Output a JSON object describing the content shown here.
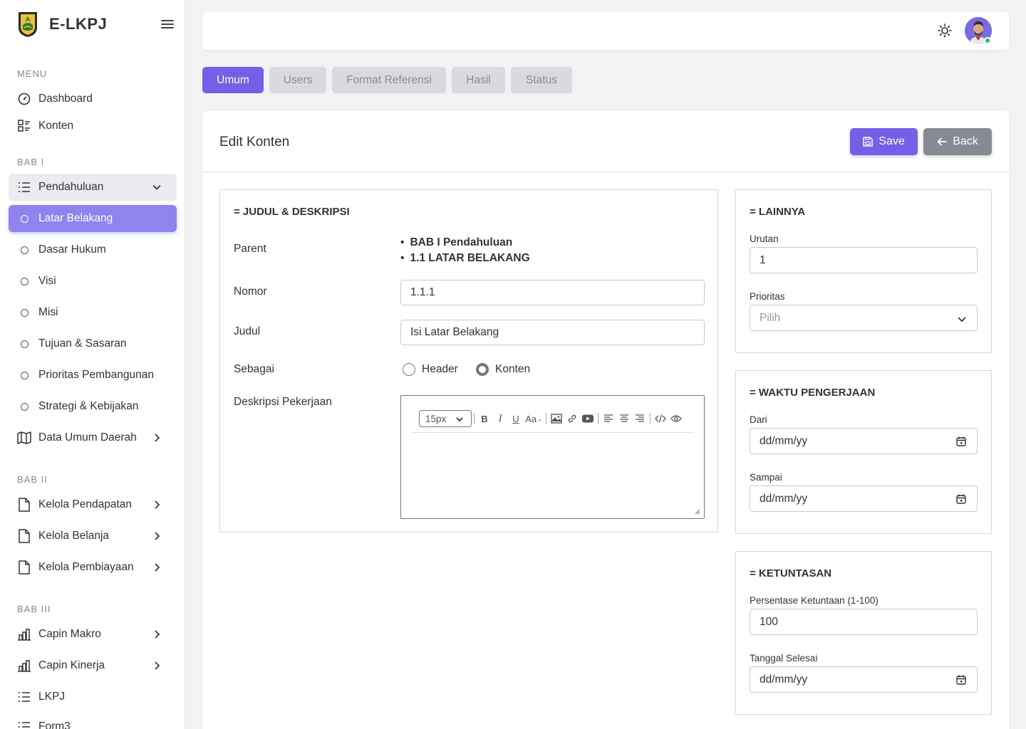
{
  "app": {
    "name": "E-LKPJ"
  },
  "sidebar": {
    "sections": [
      {
        "label": "MENU"
      },
      {
        "label": "BAB I"
      },
      {
        "label": "BAB II"
      },
      {
        "label": "BAB III"
      }
    ],
    "items": [
      {
        "label": "Dashboard",
        "icon": "dashboard-icon"
      },
      {
        "label": "Konten",
        "icon": "list-grid-icon"
      },
      {
        "label": "Pendahuluan",
        "icon": "list-icon"
      },
      {
        "label": "Latar Belakang",
        "icon": "circle-icon"
      },
      {
        "label": "Dasar Hukum",
        "icon": "circle-icon"
      },
      {
        "label": "Visi",
        "icon": "circle-icon"
      },
      {
        "label": "Misi",
        "icon": "circle-icon"
      },
      {
        "label": "Tujuan & Sasaran",
        "icon": "circle-icon"
      },
      {
        "label": "Prioritas Pembangunan",
        "icon": "circle-icon"
      },
      {
        "label": "Strategi & Kebijakan",
        "icon": "circle-icon"
      },
      {
        "label": "Data Umum Daerah",
        "icon": "map-icon"
      },
      {
        "label": "Kelola Pendapatan",
        "icon": "file-icon"
      },
      {
        "label": "Kelola Belanja",
        "icon": "file-icon"
      },
      {
        "label": "Kelola Pembiayaan",
        "icon": "file-icon"
      },
      {
        "label": "Capin Makro",
        "icon": "bar-chart-icon"
      },
      {
        "label": "Capin Kinerja",
        "icon": "bar-chart-icon"
      },
      {
        "label": "LKPJ",
        "icon": "list-icon"
      },
      {
        "label": "Form3",
        "icon": "list-icon"
      }
    ]
  },
  "tabs": [
    {
      "label": "Umum"
    },
    {
      "label": "Users"
    },
    {
      "label": "Format Referensi"
    },
    {
      "label": "Hasil"
    },
    {
      "label": "Status"
    }
  ],
  "card": {
    "title": "Edit Konten",
    "save_label": "Save",
    "back_label": "Back"
  },
  "judul_panel": {
    "title": "= JUDUL & DESKRIPSI",
    "parent_label": "Parent",
    "parent_items": [
      "BAB I Pendahuluan",
      "1.1 LATAR BELAKANG"
    ],
    "nomor_label": "Nomor",
    "nomor_value": "1.1.1",
    "judul_label": "Judul",
    "judul_value": "Isi Latar Belakang",
    "sebagai_label": "Sebagai",
    "radio_header": "Header",
    "radio_konten": "Konten",
    "radio_selected": "Konten",
    "deskripsi_label": "Deskripsi Pekerjaan",
    "font_size": "15px",
    "format_case_label": "Aa"
  },
  "lainnya_panel": {
    "title": "= LAINNYA",
    "urutan_label": "Urutan",
    "urutan_value": "1",
    "prioritas_label": "Prioritas",
    "prioritas_placeholder": "Pilih"
  },
  "waktu_panel": {
    "title": "= WAKTU PENGERJAAN",
    "dari_label": "Dari",
    "dari_value": "dd/mm/yy",
    "sampai_label": "Sampai",
    "sampai_value": "dd/mm/yy"
  },
  "ketuntasan_panel": {
    "title": "= KETUNTASAN",
    "persentase_label": "Persentase Ketuntaan (1-100)",
    "persentase_value": "100",
    "tanggal_label": "Tanggal Selesai",
    "tanggal_value": "dd/mm/yy"
  },
  "colors": {
    "accent": "#7460e6",
    "active_nav": "#8f83ee",
    "back_button": "#868a93",
    "online": "#22c55e"
  }
}
